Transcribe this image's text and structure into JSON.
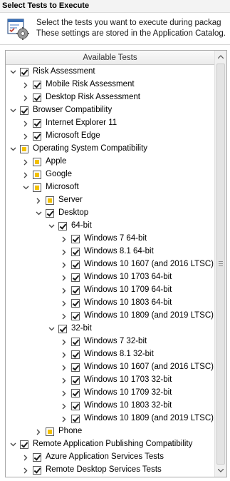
{
  "title": "Select Tests to Execute",
  "description": {
    "line1": "Select the tests you want to execute during packag",
    "line2": "These settings are stored in the Application Catalog."
  },
  "column_header": "Available Tests",
  "tree": [
    {
      "label": "Risk Assessment",
      "level": 0,
      "state": "checked",
      "expander": "down",
      "name": "risk-assessment"
    },
    {
      "label": "Mobile Risk Assessment",
      "level": 1,
      "state": "checked",
      "expander": "right",
      "name": "mobile-risk-assessment"
    },
    {
      "label": "Desktop Risk Assessment",
      "level": 1,
      "state": "checked",
      "expander": "right",
      "name": "desktop-risk-assessment"
    },
    {
      "label": "Browser Compatibility",
      "level": 0,
      "state": "checked",
      "expander": "down",
      "name": "browser-compatibility"
    },
    {
      "label": "Internet Explorer 11",
      "level": 1,
      "state": "checked",
      "expander": "right",
      "name": "internet-explorer-11"
    },
    {
      "label": "Microsoft Edge",
      "level": 1,
      "state": "checked",
      "expander": "right",
      "name": "microsoft-edge"
    },
    {
      "label": "Operating System Compatibility",
      "level": 0,
      "state": "partial",
      "expander": "down",
      "name": "os-compatibility"
    },
    {
      "label": "Apple",
      "level": 1,
      "state": "partial",
      "expander": "right",
      "name": "apple"
    },
    {
      "label": "Google",
      "level": 1,
      "state": "partial",
      "expander": "right",
      "name": "google"
    },
    {
      "label": "Microsoft",
      "level": 1,
      "state": "partial",
      "expander": "down",
      "name": "microsoft"
    },
    {
      "label": "Server",
      "level": 2,
      "state": "partial",
      "expander": "right",
      "name": "server"
    },
    {
      "label": "Desktop",
      "level": 2,
      "state": "checked",
      "expander": "down",
      "name": "desktop"
    },
    {
      "label": "64-bit",
      "level": 3,
      "state": "checked",
      "expander": "down",
      "name": "64-bit"
    },
    {
      "label": "Windows 7 64-bit",
      "level": 4,
      "state": "checked",
      "expander": "right",
      "name": "win7-64"
    },
    {
      "label": "Windows 8.1 64-bit",
      "level": 4,
      "state": "checked",
      "expander": "right",
      "name": "win81-64"
    },
    {
      "label": "Windows 10 1607 (and 2016 LTSC)...",
      "level": 4,
      "state": "checked",
      "expander": "right",
      "name": "win10-1607-64"
    },
    {
      "label": "Windows 10 1703 64-bit",
      "level": 4,
      "state": "checked",
      "expander": "right",
      "name": "win10-1703-64"
    },
    {
      "label": "Windows 10 1709 64-bit",
      "level": 4,
      "state": "checked",
      "expander": "right",
      "name": "win10-1709-64"
    },
    {
      "label": "Windows 10 1803 64-bit",
      "level": 4,
      "state": "checked",
      "expander": "right",
      "name": "win10-1803-64"
    },
    {
      "label": "Windows 10 1809 (and 2019 LTSC)...",
      "level": 4,
      "state": "checked",
      "expander": "right",
      "name": "win10-1809-64"
    },
    {
      "label": "32-bit",
      "level": 3,
      "state": "checked",
      "expander": "down",
      "name": "32-bit"
    },
    {
      "label": "Windows 7 32-bit",
      "level": 4,
      "state": "checked",
      "expander": "right",
      "name": "win7-32"
    },
    {
      "label": "Windows 8.1 32-bit",
      "level": 4,
      "state": "checked",
      "expander": "right",
      "name": "win81-32"
    },
    {
      "label": "Windows 10 1607 (and 2016 LTSC)...",
      "level": 4,
      "state": "checked",
      "expander": "right",
      "name": "win10-1607-32"
    },
    {
      "label": "Windows 10 1703 32-bit",
      "level": 4,
      "state": "checked",
      "expander": "right",
      "name": "win10-1703-32"
    },
    {
      "label": "Windows 10 1709 32-bit",
      "level": 4,
      "state": "checked",
      "expander": "right",
      "name": "win10-1709-32"
    },
    {
      "label": "Windows 10 1803 32-bit",
      "level": 4,
      "state": "checked",
      "expander": "right",
      "name": "win10-1803-32"
    },
    {
      "label": "Windows 10 1809 (and 2019 LTSC)...",
      "level": 4,
      "state": "checked",
      "expander": "right",
      "name": "win10-1809-32"
    },
    {
      "label": "Phone",
      "level": 2,
      "state": "partial",
      "expander": "right",
      "name": "phone"
    },
    {
      "label": "Remote Application Publishing Compatibility",
      "level": 0,
      "state": "checked",
      "expander": "down",
      "name": "remote-app-publishing"
    },
    {
      "label": "Azure Application Services Tests",
      "level": 1,
      "state": "checked",
      "expander": "right",
      "name": "azure-app-services"
    },
    {
      "label": "Remote Desktop Services Tests",
      "level": 1,
      "state": "checked",
      "expander": "right",
      "name": "remote-desktop-services"
    }
  ]
}
